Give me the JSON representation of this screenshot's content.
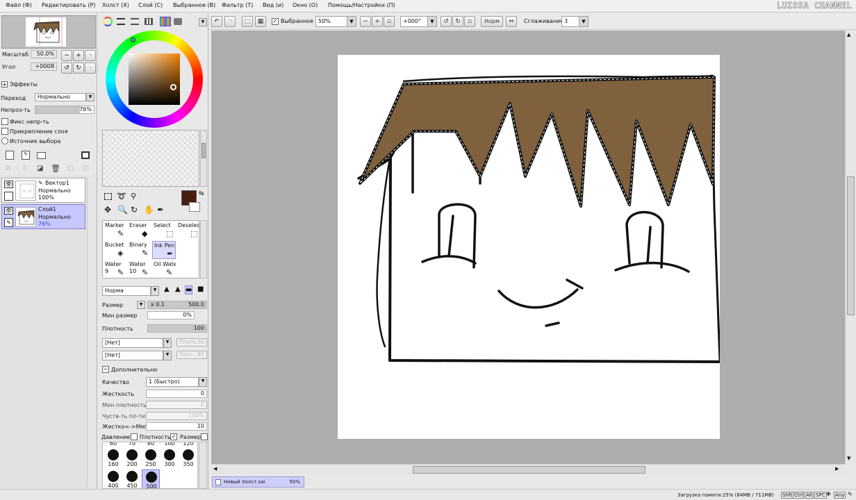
{
  "menu": [
    "Файл (Ф)",
    "Редактировать (Р)",
    "Холст (Х)",
    "Слой (С)",
    "Выбранное (В)",
    "Фильтр (Т)",
    "Вид (и)",
    "Окно (О)",
    "Помощь/Настройки (П)"
  ],
  "watermark": "LUISSA CHANNEL",
  "navigator": {
    "zoom_label": "Масштаб",
    "zoom_value": "50.0%",
    "angle_label": "Угол",
    "angle_value": "+000Я"
  },
  "effects": {
    "title": "Эффекты",
    "blend_label": "Переход",
    "blend_value": "Нормально",
    "opacity_label": "Непроз-ть",
    "opacity_value": "76%",
    "opacity_fraction": 0.76,
    "lock_opacity": "Фикс непр-ть",
    "clip_layer": "Прикрепление слоя",
    "selection_source": "Источник выбора"
  },
  "layers": [
    {
      "name": "Вектор1",
      "mode": "Нормально",
      "opacity": "100%",
      "selected": false
    },
    {
      "name": "Слой1",
      "mode": "Нормально",
      "opacity": "76%",
      "selected": true
    }
  ],
  "colors": {
    "primary": "#4a1d12",
    "secondary": "#ffffff",
    "hair": "#80613e",
    "canvas_bg": "#adadad",
    "selected": "#c8c8ff"
  },
  "brush_list": [
    {
      "name": "Marker",
      "icon": "marker-icon"
    },
    {
      "name": "Eraser",
      "icon": "eraser-icon"
    },
    {
      "name": "Select",
      "icon": "select-icon"
    },
    {
      "name": "Deselect",
      "icon": "deselect-icon"
    },
    {
      "name": "Bucket",
      "icon": "bucket-icon"
    },
    {
      "name": "Binary",
      "icon": "binary-icon"
    },
    {
      "name": "Ink Pen",
      "icon": "ink-pen-icon",
      "active": true
    },
    {
      "name": "",
      "icon": ""
    },
    {
      "name": "Water",
      "sub": "9",
      "icon": "water-icon"
    },
    {
      "name": "Water",
      "sub": "10",
      "icon": "water-icon"
    },
    {
      "name": "Oil Water",
      "icon": "oil-water-icon"
    }
  ],
  "brush": {
    "blend": "Норма",
    "size_label": "Размер",
    "size_mult": "x 0.1",
    "size_value": "500.0",
    "min_size_label": "Мин размер",
    "min_size_value": "0%",
    "density_label": "Плотность",
    "density_value": "100",
    "shape1": "[Нет]",
    "shape1_param": "Плоть",
    "shape1_val": "50",
    "shape2": "[Нет]",
    "shape2_param": "Текс.",
    "shape2_val": "95",
    "advanced": "Дополнительно",
    "quality_label": "Качество",
    "quality_value": "1 (Быстро)",
    "edge_label": "Жесткость",
    "edge_value": "0",
    "min_density_label": "Мин плотность",
    "min_density_value": "0",
    "sens_label": "Чуств-ть пл-ти",
    "sens_value": "100%",
    "hardsoft_label": "Жестко<->Мягко",
    "hardsoft_value": "10",
    "pressure_label": "Давление:",
    "pressure_density": "Плотность",
    "pressure_size": "Размер"
  },
  "brush_sizes": {
    "top_row": [
      "60",
      "70",
      "80",
      "100",
      "120"
    ],
    "rows": [
      [
        "160",
        "200",
        "250",
        "300",
        "350"
      ],
      [
        "400",
        "450",
        "500"
      ]
    ],
    "selected": "500"
  },
  "toolbar": {
    "selected_label": "Выбранное",
    "zoom": "50%",
    "rotation": "+000°",
    "normal": "Норм",
    "stabilizer_label": "Сглаживание",
    "stabilizer_value": "3"
  },
  "document": {
    "name": "Новый Холст.sai",
    "zoom": "50%"
  },
  "status": {
    "memory": "Загрузка памяти:25% (84MB / 711MB)",
    "keys": [
      "Shft",
      "Ctrl",
      "Alt",
      "SPC",
      "Any"
    ]
  }
}
